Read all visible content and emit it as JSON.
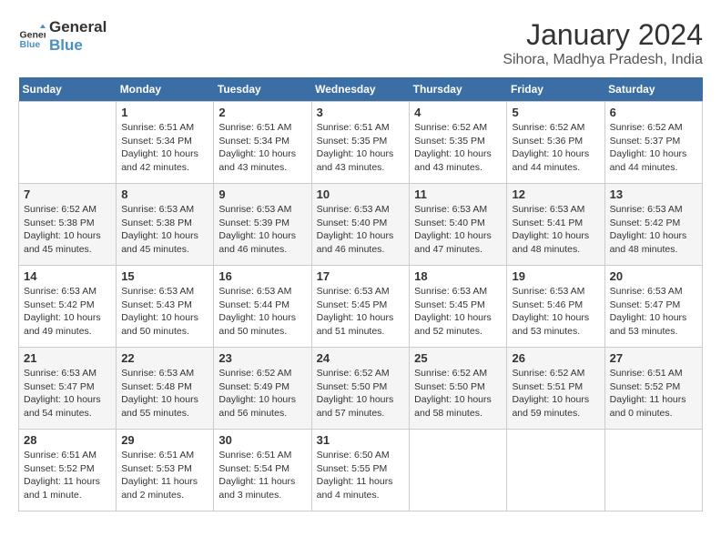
{
  "header": {
    "logo_line1": "General",
    "logo_line2": "Blue",
    "month": "January 2024",
    "location": "Sihora, Madhya Pradesh, India"
  },
  "weekdays": [
    "Sunday",
    "Monday",
    "Tuesday",
    "Wednesday",
    "Thursday",
    "Friday",
    "Saturday"
  ],
  "weeks": [
    [
      {
        "day": "",
        "info": ""
      },
      {
        "day": "1",
        "info": "Sunrise: 6:51 AM\nSunset: 5:34 PM\nDaylight: 10 hours\nand 42 minutes."
      },
      {
        "day": "2",
        "info": "Sunrise: 6:51 AM\nSunset: 5:34 PM\nDaylight: 10 hours\nand 43 minutes."
      },
      {
        "day": "3",
        "info": "Sunrise: 6:51 AM\nSunset: 5:35 PM\nDaylight: 10 hours\nand 43 minutes."
      },
      {
        "day": "4",
        "info": "Sunrise: 6:52 AM\nSunset: 5:35 PM\nDaylight: 10 hours\nand 43 minutes."
      },
      {
        "day": "5",
        "info": "Sunrise: 6:52 AM\nSunset: 5:36 PM\nDaylight: 10 hours\nand 44 minutes."
      },
      {
        "day": "6",
        "info": "Sunrise: 6:52 AM\nSunset: 5:37 PM\nDaylight: 10 hours\nand 44 minutes."
      }
    ],
    [
      {
        "day": "7",
        "info": "Sunrise: 6:52 AM\nSunset: 5:38 PM\nDaylight: 10 hours\nand 45 minutes."
      },
      {
        "day": "8",
        "info": "Sunrise: 6:53 AM\nSunset: 5:38 PM\nDaylight: 10 hours\nand 45 minutes."
      },
      {
        "day": "9",
        "info": "Sunrise: 6:53 AM\nSunset: 5:39 PM\nDaylight: 10 hours\nand 46 minutes."
      },
      {
        "day": "10",
        "info": "Sunrise: 6:53 AM\nSunset: 5:40 PM\nDaylight: 10 hours\nand 46 minutes."
      },
      {
        "day": "11",
        "info": "Sunrise: 6:53 AM\nSunset: 5:40 PM\nDaylight: 10 hours\nand 47 minutes."
      },
      {
        "day": "12",
        "info": "Sunrise: 6:53 AM\nSunset: 5:41 PM\nDaylight: 10 hours\nand 48 minutes."
      },
      {
        "day": "13",
        "info": "Sunrise: 6:53 AM\nSunset: 5:42 PM\nDaylight: 10 hours\nand 48 minutes."
      }
    ],
    [
      {
        "day": "14",
        "info": "Sunrise: 6:53 AM\nSunset: 5:42 PM\nDaylight: 10 hours\nand 49 minutes."
      },
      {
        "day": "15",
        "info": "Sunrise: 6:53 AM\nSunset: 5:43 PM\nDaylight: 10 hours\nand 50 minutes."
      },
      {
        "day": "16",
        "info": "Sunrise: 6:53 AM\nSunset: 5:44 PM\nDaylight: 10 hours\nand 50 minutes."
      },
      {
        "day": "17",
        "info": "Sunrise: 6:53 AM\nSunset: 5:45 PM\nDaylight: 10 hours\nand 51 minutes."
      },
      {
        "day": "18",
        "info": "Sunrise: 6:53 AM\nSunset: 5:45 PM\nDaylight: 10 hours\nand 52 minutes."
      },
      {
        "day": "19",
        "info": "Sunrise: 6:53 AM\nSunset: 5:46 PM\nDaylight: 10 hours\nand 53 minutes."
      },
      {
        "day": "20",
        "info": "Sunrise: 6:53 AM\nSunset: 5:47 PM\nDaylight: 10 hours\nand 53 minutes."
      }
    ],
    [
      {
        "day": "21",
        "info": "Sunrise: 6:53 AM\nSunset: 5:47 PM\nDaylight: 10 hours\nand 54 minutes."
      },
      {
        "day": "22",
        "info": "Sunrise: 6:53 AM\nSunset: 5:48 PM\nDaylight: 10 hours\nand 55 minutes."
      },
      {
        "day": "23",
        "info": "Sunrise: 6:52 AM\nSunset: 5:49 PM\nDaylight: 10 hours\nand 56 minutes."
      },
      {
        "day": "24",
        "info": "Sunrise: 6:52 AM\nSunset: 5:50 PM\nDaylight: 10 hours\nand 57 minutes."
      },
      {
        "day": "25",
        "info": "Sunrise: 6:52 AM\nSunset: 5:50 PM\nDaylight: 10 hours\nand 58 minutes."
      },
      {
        "day": "26",
        "info": "Sunrise: 6:52 AM\nSunset: 5:51 PM\nDaylight: 10 hours\nand 59 minutes."
      },
      {
        "day": "27",
        "info": "Sunrise: 6:51 AM\nSunset: 5:52 PM\nDaylight: 11 hours\nand 0 minutes."
      }
    ],
    [
      {
        "day": "28",
        "info": "Sunrise: 6:51 AM\nSunset: 5:52 PM\nDaylight: 11 hours\nand 1 minute."
      },
      {
        "day": "29",
        "info": "Sunrise: 6:51 AM\nSunset: 5:53 PM\nDaylight: 11 hours\nand 2 minutes."
      },
      {
        "day": "30",
        "info": "Sunrise: 6:51 AM\nSunset: 5:54 PM\nDaylight: 11 hours\nand 3 minutes."
      },
      {
        "day": "31",
        "info": "Sunrise: 6:50 AM\nSunset: 5:55 PM\nDaylight: 11 hours\nand 4 minutes."
      },
      {
        "day": "",
        "info": ""
      },
      {
        "day": "",
        "info": ""
      },
      {
        "day": "",
        "info": ""
      }
    ]
  ]
}
